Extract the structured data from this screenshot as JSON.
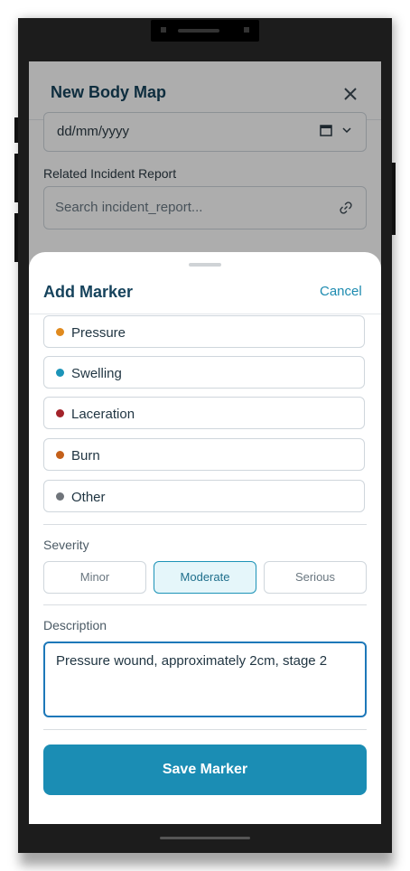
{
  "base_modal": {
    "title": "New Body Map",
    "date_placeholder": "dd/mm/yyyy",
    "incident_label": "Related Incident Report",
    "incident_placeholder": "Search incident_report..."
  },
  "sheet": {
    "title": "Add Marker",
    "cancel_label": "Cancel",
    "marker_types": [
      {
        "label": "Pressure",
        "color": "#e08a1e"
      },
      {
        "label": "Swelling",
        "color": "#1c94b8"
      },
      {
        "label": "Laceration",
        "color": "#a3232a"
      },
      {
        "label": "Burn",
        "color": "#c4601a"
      },
      {
        "label": "Other",
        "color": "#6f747a"
      }
    ],
    "severity_label": "Severity",
    "severity_options": [
      "Minor",
      "Moderate",
      "Serious"
    ],
    "severity_selected": "Moderate",
    "description_label": "Description",
    "description_value": "Pressure wound, approximately 2cm, stage 2",
    "save_label": "Save Marker"
  },
  "colors": {
    "accent": "#1b8db4",
    "title": "#16435c",
    "focus_border": "#1d78b9"
  }
}
